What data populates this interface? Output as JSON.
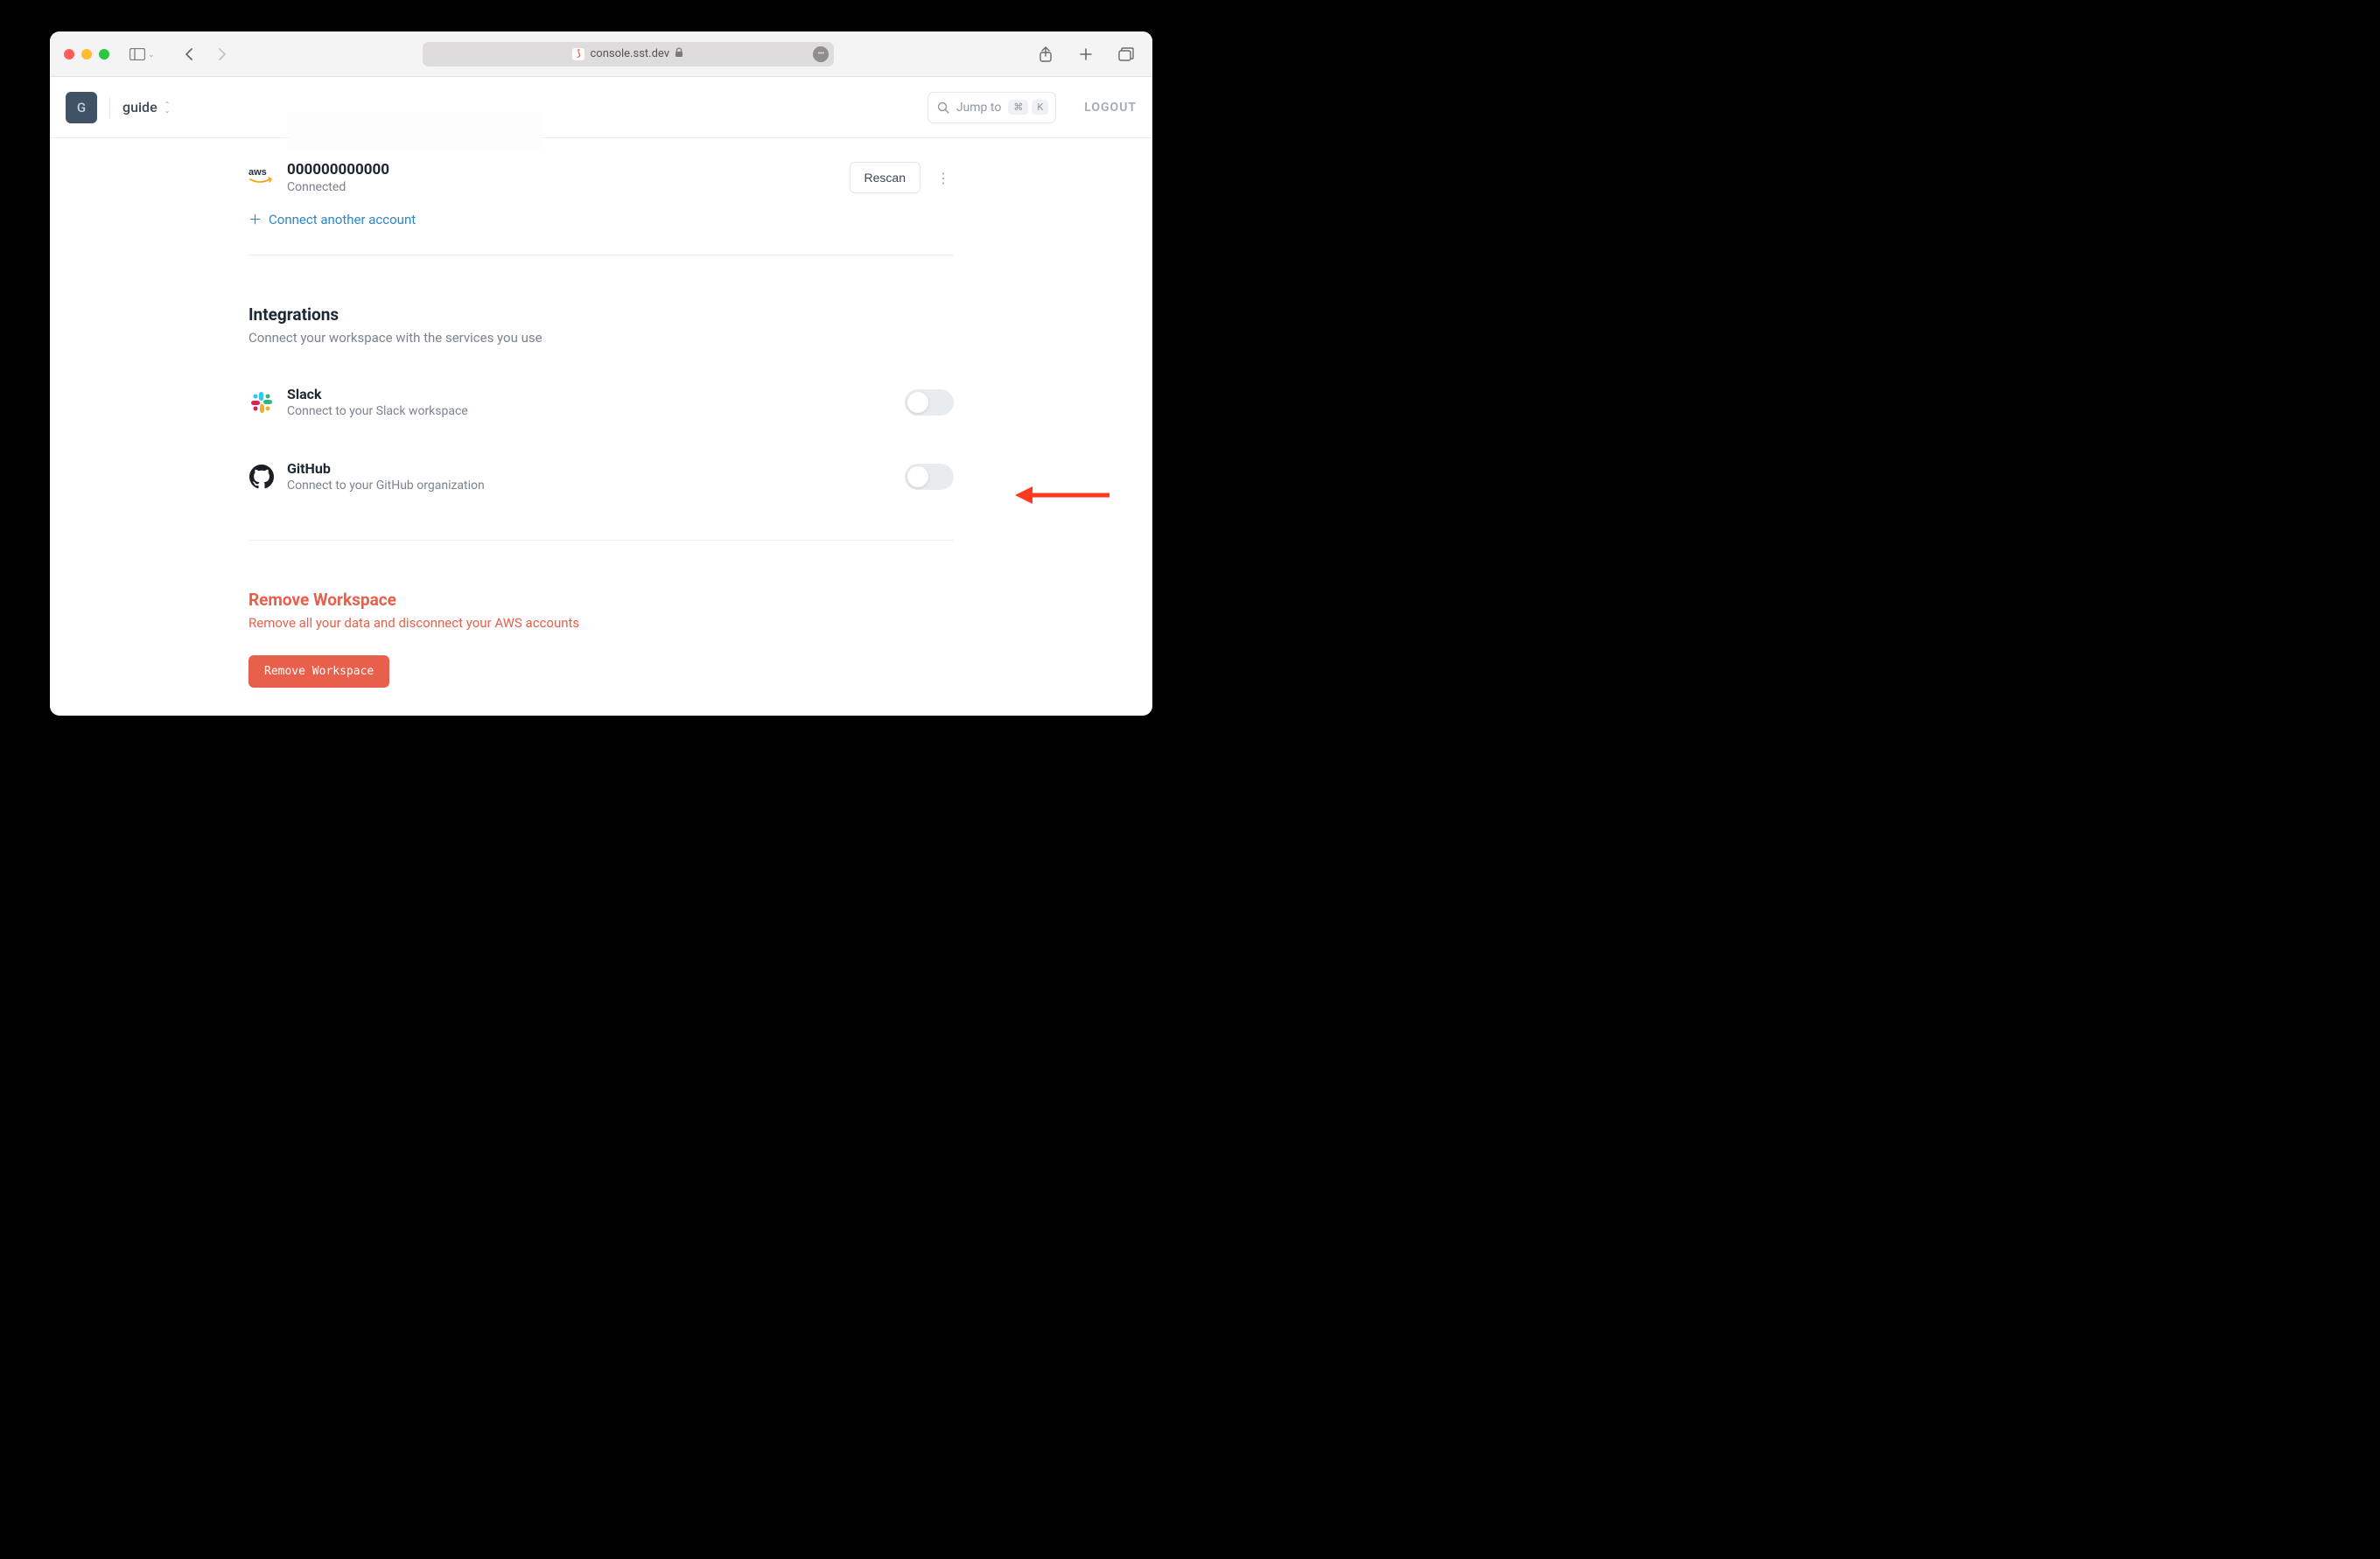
{
  "browser": {
    "url": "console.sst.dev"
  },
  "header": {
    "workspace_initial": "G",
    "workspace_name": "guide",
    "jump_label": "Jump to",
    "jump_key1": "⌘",
    "jump_key2": "K",
    "logout": "LOGOUT"
  },
  "aws": {
    "account_id": "000000000000",
    "status": "Connected",
    "rescan": "Rescan",
    "connect_another": "Connect another account"
  },
  "integrations": {
    "title": "Integrations",
    "subtitle": "Connect your workspace with the services you use",
    "slack": {
      "title": "Slack",
      "subtitle": "Connect to your Slack workspace"
    },
    "github": {
      "title": "GitHub",
      "subtitle": "Connect to your GitHub organization"
    }
  },
  "danger": {
    "title": "Remove Workspace",
    "subtitle": "Remove all your data and disconnect your AWS accounts",
    "button": "Remove Workspace"
  }
}
